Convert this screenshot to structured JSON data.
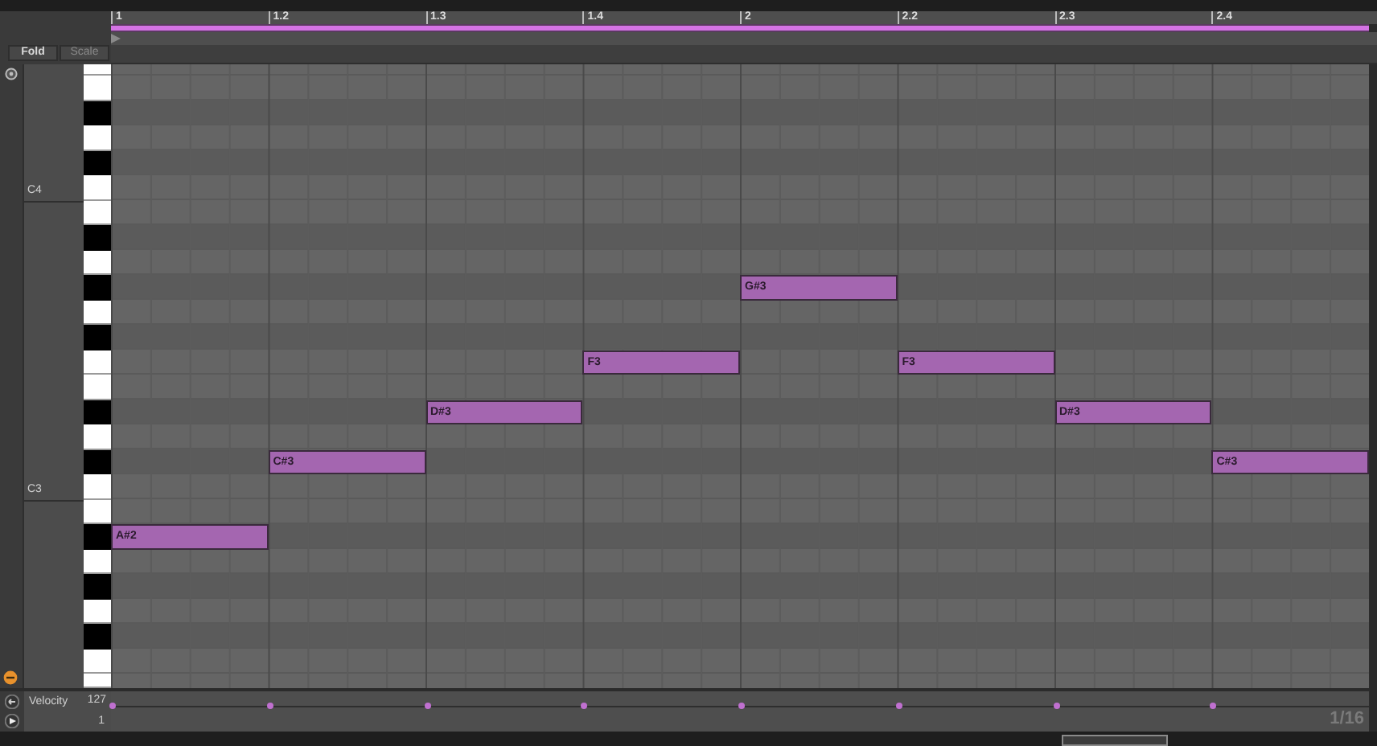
{
  "editor": {
    "fold_button": "Fold",
    "scale_button": "Scale",
    "grid_resolution": "1/16"
  },
  "ruler": [
    "1",
    "1.2",
    "1.3",
    "1.4",
    "2",
    "2.2",
    "2.3",
    "2.4"
  ],
  "piano_keys": [
    {
      "kind": "white"
    },
    {
      "kind": "white"
    },
    {
      "kind": "black"
    },
    {
      "kind": "white"
    },
    {
      "kind": "black"
    },
    {
      "kind": "white",
      "label": "C4"
    },
    {
      "kind": "white"
    },
    {
      "kind": "black"
    },
    {
      "kind": "white"
    },
    {
      "kind": "black"
    },
    {
      "kind": "white"
    },
    {
      "kind": "black"
    },
    {
      "kind": "white"
    },
    {
      "kind": "white"
    },
    {
      "kind": "black"
    },
    {
      "kind": "white"
    },
    {
      "kind": "black"
    },
    {
      "kind": "white",
      "label": "C3"
    },
    {
      "kind": "white"
    },
    {
      "kind": "black"
    },
    {
      "kind": "white"
    },
    {
      "kind": "black"
    },
    {
      "kind": "white"
    },
    {
      "kind": "black"
    },
    {
      "kind": "white"
    },
    {
      "kind": "white"
    }
  ],
  "notes": [
    {
      "label": "A#2"
    },
    {
      "label": "C#3"
    },
    {
      "label": "D#3"
    },
    {
      "label": "F3"
    },
    {
      "label": "G#3"
    },
    {
      "label": "F3"
    },
    {
      "label": "D#3"
    },
    {
      "label": "C#3"
    }
  ],
  "velocity_lane": {
    "title": "Velocity",
    "max": "127",
    "min": "1"
  }
}
